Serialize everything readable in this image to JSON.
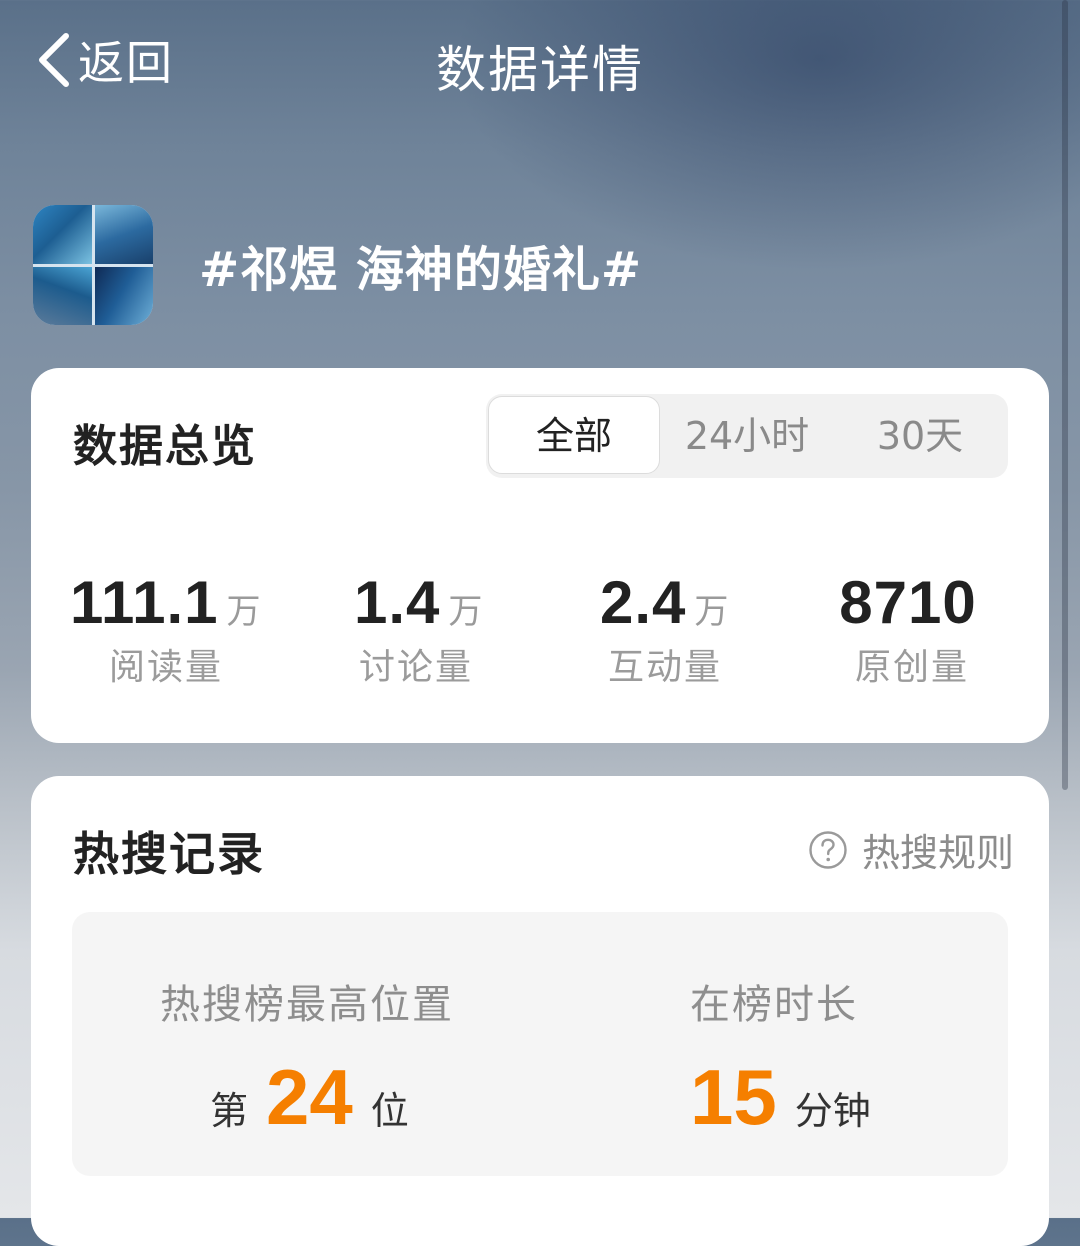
{
  "header": {
    "back_label": "返回",
    "title": "数据详情"
  },
  "topic": {
    "name": "#祁煜 海神的婚礼#"
  },
  "overview": {
    "title": "数据总览",
    "tabs": [
      {
        "label": "全部",
        "selected": true
      },
      {
        "label": "24小时",
        "selected": false
      },
      {
        "label": "30天",
        "selected": false
      }
    ],
    "stats": [
      {
        "value": "111.1",
        "unit": "万",
        "label": "阅读量"
      },
      {
        "value": "1.4",
        "unit": "万",
        "label": "讨论量"
      },
      {
        "value": "2.4",
        "unit": "万",
        "label": "互动量"
      },
      {
        "value": "8710",
        "unit": "",
        "label": "原创量"
      }
    ]
  },
  "hot_search": {
    "title": "热搜记录",
    "rules_label": "热搜规则",
    "peak_label": "热搜榜最高位置",
    "peak_prefix": "第",
    "peak_value": "24",
    "peak_suffix": "位",
    "duration_label": "在榜时长",
    "duration_value": "15",
    "duration_unit": "分钟"
  },
  "colors": {
    "accent_orange": "#f57f00",
    "card_bg": "#ffffff",
    "text_primary": "#222222",
    "text_secondary": "#9b9b9b"
  },
  "icons": [
    "chevron-left-icon",
    "question-circle-icon"
  ]
}
